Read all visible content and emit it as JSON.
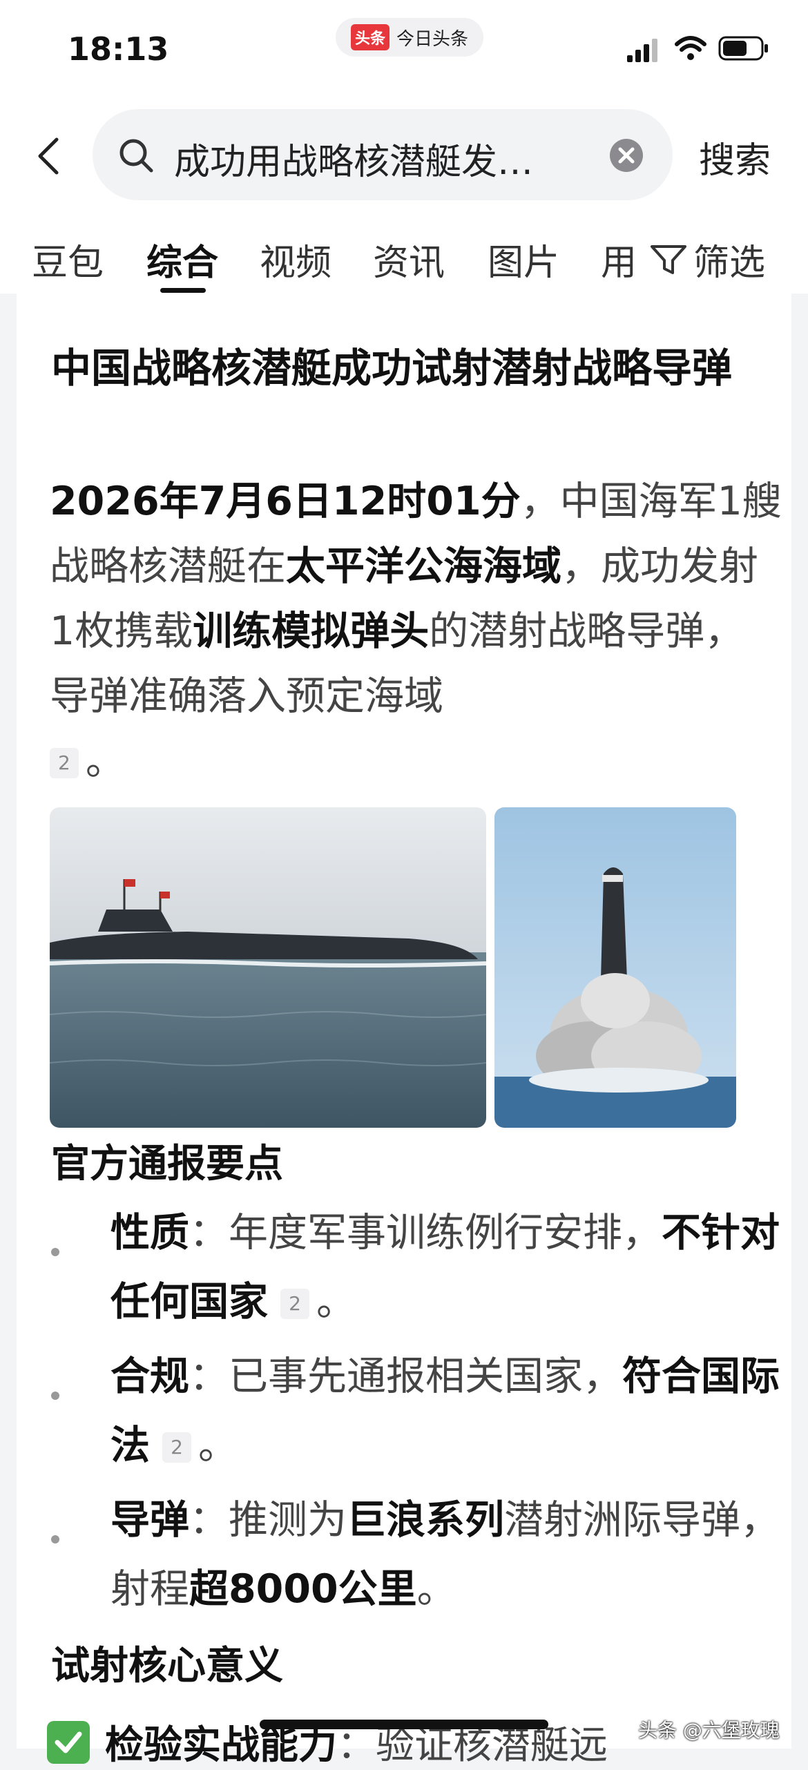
{
  "status_bar": {
    "time": "18:13",
    "app_badge": "头条",
    "app_name": "今日头条"
  },
  "search": {
    "query": "成功用战略核潜艇发…",
    "button": "搜索"
  },
  "tabs": [
    {
      "label": "豆包"
    },
    {
      "label": "综合",
      "active": true
    },
    {
      "label": "视频"
    },
    {
      "label": "资讯"
    },
    {
      "label": "图片"
    },
    {
      "label": "用"
    }
  ],
  "filter_label": "筛选",
  "article": {
    "headline": "中国战略核潜艇成功试射潜射战略导弹",
    "p1_bold1": "2026年7月6日12时01分",
    "p1_t1": "，中国海军1艘战略核潜艇在",
    "p1_bold2": "太平洋公海海域",
    "p1_t2": "，成功发射1枚携载",
    "p1_bold3": "训练模拟弹头",
    "p1_t3": "的潜射战略导弹，导弹准确落入预定海域",
    "p1_cite": "2",
    "p1_end": "。",
    "section1": "官方通报要点",
    "bullets": [
      {
        "label": "性质",
        "sep": "：",
        "t1": "年度军事训练例行安排，",
        "bold": "不针对任何国家",
        "cite": "2",
        "end": "。"
      },
      {
        "label": "合规",
        "sep": "：",
        "t1": "已事先通报相关国家，",
        "bold": "符合国际法",
        "cite": "2",
        "end": "。"
      },
      {
        "label": "导弹",
        "sep": "：",
        "t1": "推测为",
        "bold": "巨浪系列",
        "t2": "潜射洲际导弹，射程",
        "bold2": "超8000公里",
        "end": "。"
      }
    ],
    "section2": "试射核心意义",
    "peek_bold": "检验实战能力",
    "peek_rest": "：验证核潜艇远"
  },
  "watermark": "头条 @六堡玫瑰",
  "colors": {
    "accent_red": "#e8373c",
    "check_green": "#4caf50"
  }
}
